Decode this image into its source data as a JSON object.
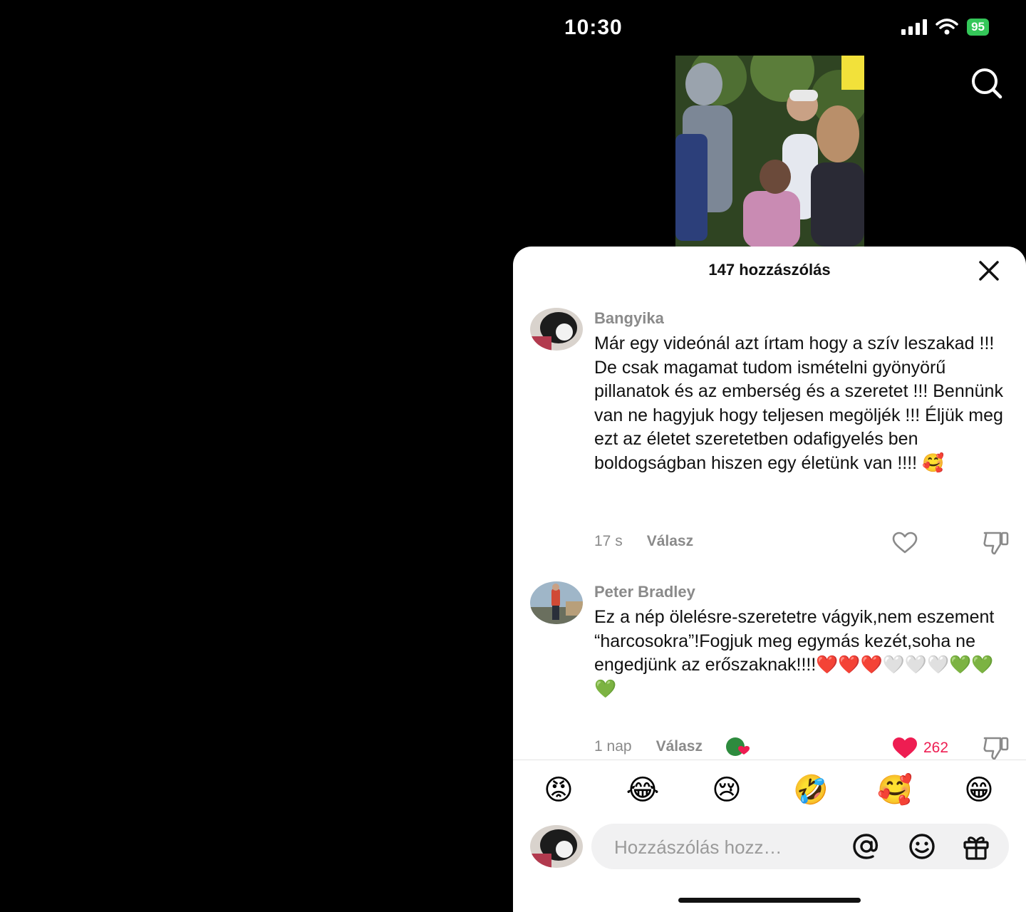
{
  "status": {
    "time": "10:30",
    "battery": "95"
  },
  "sheet": {
    "title": "147 hozzászólás"
  },
  "comments": [
    {
      "username": "Bangyika",
      "text": "Már egy videónál azt írtam hogy a szív leszakad !!! De csak magamat tudom ismételni gyönyörű pillanatok és az emberség és a szeretet !!! Bennünk van ne hagyjuk hogy teljesen megöljék !!! Éljük meg ezt az életet szeretetben odafigyelés ben boldogságban hiszen egy életünk van !!!! 🥰",
      "time": "17 s",
      "reply_label": "Válasz",
      "liked": false,
      "like_count": ""
    },
    {
      "username": "Peter Bradley",
      "text": "Ez a nép ölelésre-szeretetre vágyik,nem eszement “harcosokra”!Fogjuk meg egymás kezét,soha ne engedjünk az erőszaknak!!!!❤️❤️❤️🤍🤍🤍💚💚💚",
      "time": "1 nap",
      "reply_label": "Válasz",
      "liked": true,
      "like_count": "262"
    }
  ],
  "emoji_bar": [
    "😡",
    "😂",
    "😢",
    "🤣",
    "🥰",
    "😁"
  ],
  "composer": {
    "placeholder": "Hozzászólás hozz…"
  },
  "colors": {
    "like_red": "#ee1d52",
    "battery_green": "#34c759",
    "meta_gray": "#8a8a8a"
  },
  "icons": [
    "search-icon",
    "close-icon",
    "heart-icon",
    "dislike-icon",
    "at-icon",
    "emoji-icon",
    "gift-icon"
  ]
}
